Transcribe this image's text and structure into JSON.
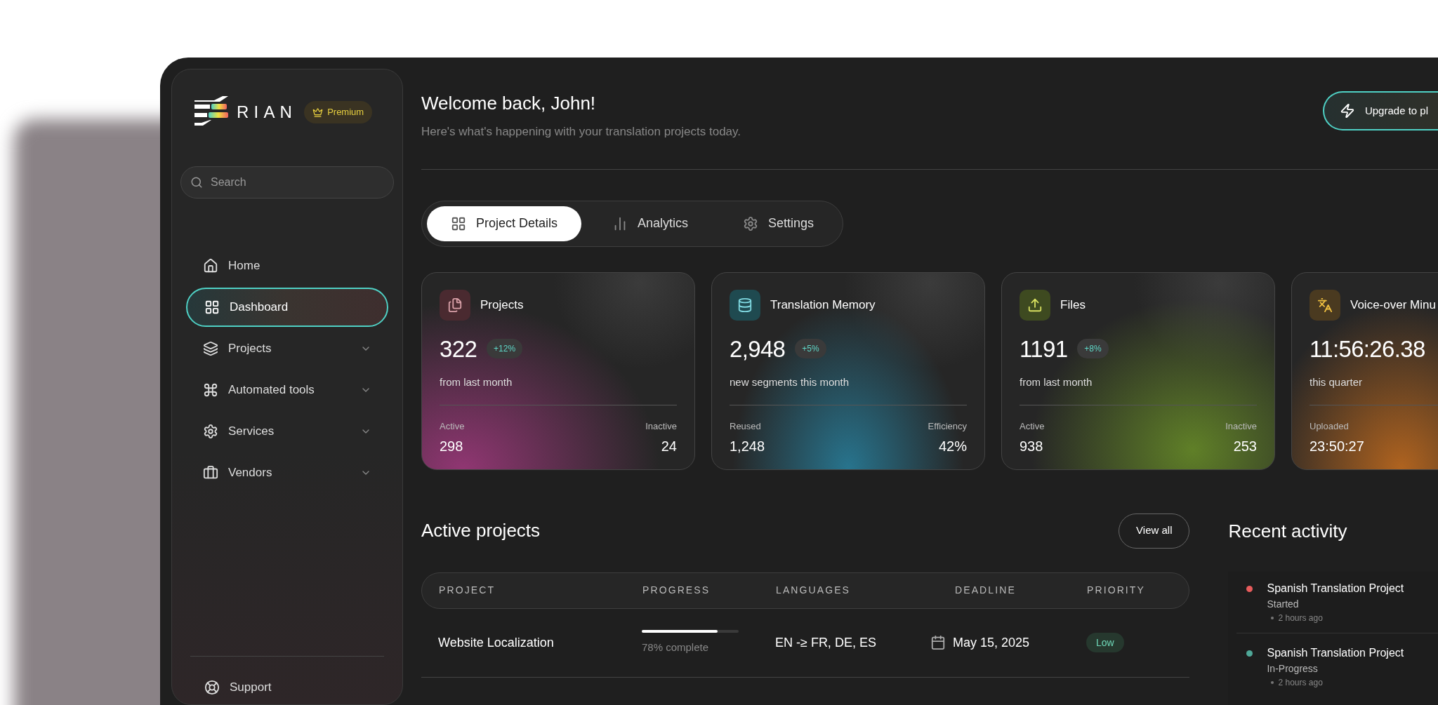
{
  "brand": {
    "name": "RIAN",
    "badge": "Premium"
  },
  "search": {
    "placeholder": "Search"
  },
  "nav": [
    {
      "label": "Home",
      "selected": false
    },
    {
      "label": "Dashboard",
      "selected": true
    },
    {
      "label": "Projects",
      "selected": false,
      "expanded": false
    },
    {
      "label": "Automated tools",
      "selected": false,
      "expanded": false
    },
    {
      "label": "Services",
      "selected": false,
      "expanded": false
    },
    {
      "label": "Vendors",
      "selected": false,
      "expanded": false
    }
  ],
  "support": {
    "label": "Support"
  },
  "header": {
    "title": "Welcome back, John!",
    "subtitle": "Here's what's happening with your translation projects today.",
    "upgrade_button": "Upgrade to pl"
  },
  "tabs": [
    {
      "label": "Project Details",
      "selected": true
    },
    {
      "label": "Analytics",
      "selected": false
    },
    {
      "label": "Settings",
      "selected": false
    }
  ],
  "cards": [
    {
      "title": "Projects",
      "value": "322",
      "change": "+12%",
      "caption": "from last month",
      "stats": [
        {
          "label": "Active",
          "value": "298"
        },
        {
          "label": "Inactive",
          "value": "24"
        }
      ]
    },
    {
      "title": "Translation Memory",
      "value": "2,948",
      "change": "+5%",
      "caption": "new segments this month",
      "stats": [
        {
          "label": "Reused",
          "value": "1,248"
        },
        {
          "label": "Efficiency",
          "value": "42%"
        }
      ]
    },
    {
      "title": "Files",
      "value": "1191",
      "change": "+8%",
      "caption": "from last month",
      "stats": [
        {
          "label": "Active",
          "value": "938"
        },
        {
          "label": "Inactive",
          "value": "253"
        }
      ]
    },
    {
      "title": "Voice-over Minu",
      "value": "11:56:26.38",
      "caption": "this quarter",
      "stats": [
        {
          "label": "Uploaded",
          "value": "23:50:27"
        }
      ]
    }
  ],
  "active_projects": {
    "title": "Active projects",
    "view_all": "View all",
    "columns": [
      "PROJECT",
      "PROGRESS",
      "LANGUAGES",
      "DEADLINE",
      "PRIORITY"
    ],
    "rows": [
      {
        "project": "Website Localization",
        "level": 0.78,
        "progress": "78% complete",
        "languages": "EN -≥ FR, DE, ES",
        "deadline": "May 15, 2025",
        "priority": "Low"
      }
    ]
  },
  "recent_activity": {
    "title": "Recent activity",
    "items": [
      {
        "title": "Spanish Translation Project",
        "status": "Started",
        "time": "2 hours ago",
        "color": "#e85c5c"
      },
      {
        "title": "Spanish Translation Project",
        "status": "In-Progress",
        "time": "2 hours ago",
        "color": "#4fa898"
      }
    ]
  }
}
